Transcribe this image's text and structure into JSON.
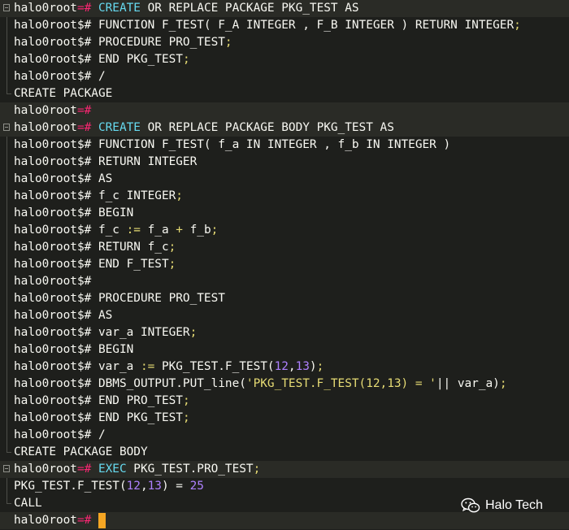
{
  "terminal": {
    "lines": [
      {
        "fold": "start",
        "hl": true,
        "segments": [
          {
            "t": "halo0root",
            "c": "t-prompt"
          },
          {
            "t": "=#",
            "c": "t-op"
          },
          {
            "t": " ",
            "c": "t-txt"
          },
          {
            "t": "CREATE",
            "c": "t-kw"
          },
          {
            "t": " OR REPLACE PACKAGE PKG_TEST AS",
            "c": "t-txt"
          }
        ]
      },
      {
        "fold": "mid",
        "segments": [
          {
            "t": "halo0root$# ",
            "c": "t-prompt"
          },
          {
            "t": "FUNCTION F_TEST( F_A INTEGER , F_B INTEGER ) RETURN INTEGER",
            "c": "t-txt"
          },
          {
            "t": ";",
            "c": "t-semi"
          }
        ]
      },
      {
        "fold": "mid",
        "segments": [
          {
            "t": "halo0root$# ",
            "c": "t-prompt"
          },
          {
            "t": "PROCEDURE PRO_TEST",
            "c": "t-txt"
          },
          {
            "t": ";",
            "c": "t-semi"
          }
        ]
      },
      {
        "fold": "mid",
        "segments": [
          {
            "t": "halo0root$# ",
            "c": "t-prompt"
          },
          {
            "t": "END PKG_TEST",
            "c": "t-txt"
          },
          {
            "t": ";",
            "c": "t-semi"
          }
        ]
      },
      {
        "fold": "mid",
        "segments": [
          {
            "t": "halo0root$# ",
            "c": "t-prompt"
          },
          {
            "t": "/",
            "c": "t-txt"
          }
        ]
      },
      {
        "fold": "end",
        "segments": [
          {
            "t": "CREATE PACKAGE",
            "c": "t-txt"
          }
        ]
      },
      {
        "fold": "",
        "hl": true,
        "segments": [
          {
            "t": "halo0root",
            "c": "t-prompt"
          },
          {
            "t": "=#",
            "c": "t-op"
          }
        ]
      },
      {
        "fold": "start",
        "hl": true,
        "segments": [
          {
            "t": "halo0root",
            "c": "t-prompt"
          },
          {
            "t": "=#",
            "c": "t-op"
          },
          {
            "t": " ",
            "c": "t-txt"
          },
          {
            "t": "CREATE",
            "c": "t-kw"
          },
          {
            "t": " OR REPLACE PACKAGE BODY PKG_TEST AS",
            "c": "t-txt"
          }
        ]
      },
      {
        "fold": "mid",
        "segments": [
          {
            "t": "halo0root$# ",
            "c": "t-prompt"
          },
          {
            "t": "FUNCTION F_TEST( f_a IN INTEGER , f_b IN INTEGER )",
            "c": "t-txt"
          }
        ]
      },
      {
        "fold": "mid",
        "segments": [
          {
            "t": "halo0root$# ",
            "c": "t-prompt"
          },
          {
            "t": "RETURN INTEGER",
            "c": "t-txt"
          }
        ]
      },
      {
        "fold": "mid",
        "segments": [
          {
            "t": "halo0root$# ",
            "c": "t-prompt"
          },
          {
            "t": "AS",
            "c": "t-txt"
          }
        ]
      },
      {
        "fold": "mid",
        "segments": [
          {
            "t": "halo0root$# ",
            "c": "t-prompt"
          },
          {
            "t": "f_c INTEGER",
            "c": "t-txt"
          },
          {
            "t": ";",
            "c": "t-semi"
          }
        ]
      },
      {
        "fold": "mid",
        "segments": [
          {
            "t": "halo0root$# ",
            "c": "t-prompt"
          },
          {
            "t": "BEGIN",
            "c": "t-txt"
          }
        ]
      },
      {
        "fold": "mid",
        "segments": [
          {
            "t": "halo0root$# ",
            "c": "t-prompt"
          },
          {
            "t": "f_c ",
            "c": "t-txt"
          },
          {
            "t": ":=",
            "c": "t-semi"
          },
          {
            "t": " f_a ",
            "c": "t-txt"
          },
          {
            "t": "+",
            "c": "t-semi"
          },
          {
            "t": " f_b",
            "c": "t-txt"
          },
          {
            "t": ";",
            "c": "t-semi"
          }
        ]
      },
      {
        "fold": "mid",
        "segments": [
          {
            "t": "halo0root$# ",
            "c": "t-prompt"
          },
          {
            "t": "RETURN f_c",
            "c": "t-txt"
          },
          {
            "t": ";",
            "c": "t-semi"
          }
        ]
      },
      {
        "fold": "mid",
        "segments": [
          {
            "t": "halo0root$# ",
            "c": "t-prompt"
          },
          {
            "t": "END F_TEST",
            "c": "t-txt"
          },
          {
            "t": ";",
            "c": "t-semi"
          }
        ]
      },
      {
        "fold": "mid",
        "segments": [
          {
            "t": "halo0root$#",
            "c": "t-prompt"
          }
        ]
      },
      {
        "fold": "mid",
        "segments": [
          {
            "t": "halo0root$# ",
            "c": "t-prompt"
          },
          {
            "t": "PROCEDURE PRO_TEST",
            "c": "t-txt"
          }
        ]
      },
      {
        "fold": "mid",
        "segments": [
          {
            "t": "halo0root$# ",
            "c": "t-prompt"
          },
          {
            "t": "AS",
            "c": "t-txt"
          }
        ]
      },
      {
        "fold": "mid",
        "segments": [
          {
            "t": "halo0root$# ",
            "c": "t-prompt"
          },
          {
            "t": "var_a INTEGER",
            "c": "t-txt"
          },
          {
            "t": ";",
            "c": "t-semi"
          }
        ]
      },
      {
        "fold": "mid",
        "segments": [
          {
            "t": "halo0root$# ",
            "c": "t-prompt"
          },
          {
            "t": "BEGIN",
            "c": "t-txt"
          }
        ]
      },
      {
        "fold": "mid",
        "segments": [
          {
            "t": "halo0root$# ",
            "c": "t-prompt"
          },
          {
            "t": "var_a ",
            "c": "t-txt"
          },
          {
            "t": ":=",
            "c": "t-semi"
          },
          {
            "t": " PKG_TEST.F_TEST(",
            "c": "t-txt"
          },
          {
            "t": "12",
            "c": "t-num"
          },
          {
            "t": ",",
            "c": "t-txt"
          },
          {
            "t": "13",
            "c": "t-num"
          },
          {
            "t": ")",
            "c": "t-txt"
          },
          {
            "t": ";",
            "c": "t-semi"
          }
        ]
      },
      {
        "fold": "mid",
        "segments": [
          {
            "t": "halo0root$# ",
            "c": "t-prompt"
          },
          {
            "t": "DBMS_OUTPUT.PUT_line(",
            "c": "t-txt"
          },
          {
            "t": "'PKG_TEST.F_TEST(12,13) = '",
            "c": "t-str"
          },
          {
            "t": "|| var_a)",
            "c": "t-txt"
          },
          {
            "t": ";",
            "c": "t-semi"
          }
        ]
      },
      {
        "fold": "mid",
        "segments": [
          {
            "t": "halo0root$# ",
            "c": "t-prompt"
          },
          {
            "t": "END PRO_TEST",
            "c": "t-txt"
          },
          {
            "t": ";",
            "c": "t-semi"
          }
        ]
      },
      {
        "fold": "mid",
        "segments": [
          {
            "t": "halo0root$# ",
            "c": "t-prompt"
          },
          {
            "t": "END PKG_TEST",
            "c": "t-txt"
          },
          {
            "t": ";",
            "c": "t-semi"
          }
        ]
      },
      {
        "fold": "mid",
        "segments": [
          {
            "t": "halo0root$# ",
            "c": "t-prompt"
          },
          {
            "t": "/",
            "c": "t-txt"
          }
        ]
      },
      {
        "fold": "end",
        "segments": [
          {
            "t": "CREATE PACKAGE BODY",
            "c": "t-txt"
          }
        ]
      },
      {
        "fold": "start",
        "hl": true,
        "segments": [
          {
            "t": "halo0root",
            "c": "t-prompt"
          },
          {
            "t": "=#",
            "c": "t-op"
          },
          {
            "t": " ",
            "c": "t-txt"
          },
          {
            "t": "EXEC",
            "c": "t-kw"
          },
          {
            "t": " PKG_TEST.PRO_TEST",
            "c": "t-txt"
          },
          {
            "t": ";",
            "c": "t-semi"
          }
        ]
      },
      {
        "fold": "mid",
        "segments": [
          {
            "t": "PKG_TEST.F_TEST(",
            "c": "t-txt"
          },
          {
            "t": "12",
            "c": "t-num"
          },
          {
            "t": ",",
            "c": "t-txt"
          },
          {
            "t": "13",
            "c": "t-num"
          },
          {
            "t": ") = ",
            "c": "t-txt"
          },
          {
            "t": "25",
            "c": "t-num"
          }
        ]
      },
      {
        "fold": "end",
        "segments": [
          {
            "t": "CALL",
            "c": "t-txt"
          }
        ]
      },
      {
        "fold": "",
        "hl": true,
        "cursor": true,
        "segments": [
          {
            "t": "halo0root",
            "c": "t-prompt"
          },
          {
            "t": "=#",
            "c": "t-op"
          },
          {
            "t": " ",
            "c": "t-txt"
          }
        ]
      }
    ]
  },
  "watermark": {
    "icon": "wechat-icon",
    "text": "Halo Tech"
  },
  "colors": {
    "background": "#1e1f1c",
    "highlight_line": "#2a2b26",
    "keyword": "#66d9ef",
    "operator": "#f92672",
    "number": "#ae81ff",
    "string": "#e6db74",
    "cursor": "#f5a623"
  }
}
